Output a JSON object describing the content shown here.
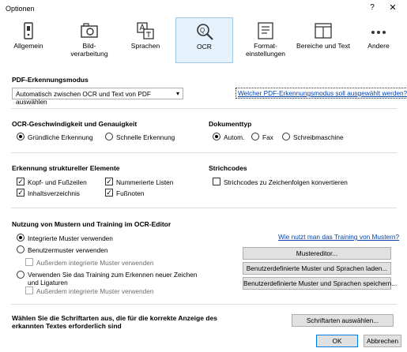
{
  "window": {
    "title": "Optionen",
    "help": "?",
    "close": "✕"
  },
  "toolbar": [
    {
      "label": "Allgemein",
      "icon": "general-icon"
    },
    {
      "label": "Bild-\nverarbeitung",
      "icon": "image-processing-icon"
    },
    {
      "label": "Sprachen",
      "icon": "languages-icon"
    },
    {
      "label": "OCR",
      "icon": "ocr-magnifier-icon",
      "active": true
    },
    {
      "label": "Format-\neinstellungen",
      "icon": "format-settings-icon"
    },
    {
      "label": "Bereiche und Text",
      "icon": "areas-text-icon"
    },
    {
      "label": "Andere",
      "icon": "more-icon"
    }
  ],
  "pdf": {
    "title": "PDF-Erkennungsmodus",
    "select_value": "Automatisch zwischen OCR und Text von PDF auswählen",
    "help_link": "Welcher PDF-Erkennungsmodus soll ausgewählt werden?"
  },
  "speed": {
    "title": "OCR-Geschwindigkeit und Genauigkeit",
    "thorough": "Gründliche Erkennung",
    "fast": "Schnelle Erkennung"
  },
  "doctype": {
    "title": "Dokumenttyp",
    "auto": "Autom.",
    "fax": "Fax",
    "typewriter": "Schreibmaschine"
  },
  "structure": {
    "title": "Erkennung struktureller Elemente",
    "headers": "Kopf- und Fußzeilen",
    "numbered": "Nummerierte Listen",
    "toc": "Inhaltsverzeichnis",
    "footnotes": "Fußnoten"
  },
  "barcodes": {
    "title": "Strichcodes",
    "convert": "Strichcodes zu Zeichenfolgen konvertieren"
  },
  "training": {
    "title": "Nutzung von Mustern und Training im OCR-Editor",
    "help_link": "Wie nutzt man das Training von Mustern?",
    "builtin": "Integrierte Muster verwenden",
    "user": "Benutzermuster verwenden",
    "also_builtin_1": "Außerdem integrierte Muster verwenden",
    "use_training_line1": "Verwenden Sie das Training zum Erkennen neuer Zeichen",
    "use_training_line2": "und Ligaturen",
    "also_builtin_2": "Außerdem integrierte Muster verwenden",
    "pattern_editor": "Mustereditor...",
    "load_patterns": "Benutzerdefinierte Muster und Sprachen laden...",
    "save_patterns": "Benutzerdefinierte Muster und Sprachen speichern..."
  },
  "fonts": {
    "line1": "Wählen Sie die Schriftarten aus, die für die korrekte Anzeige des",
    "line2": "erkannten Textes erforderlich sind",
    "select_button": "Schriftarten auswählen..."
  },
  "footer": {
    "ok": "OK",
    "cancel": "Abbrechen"
  },
  "colors": {
    "link": "#0645ad",
    "active_tab_bg": "#e5f1fb",
    "active_tab_border": "#9fc7e8",
    "primary_border": "#0078d7"
  }
}
